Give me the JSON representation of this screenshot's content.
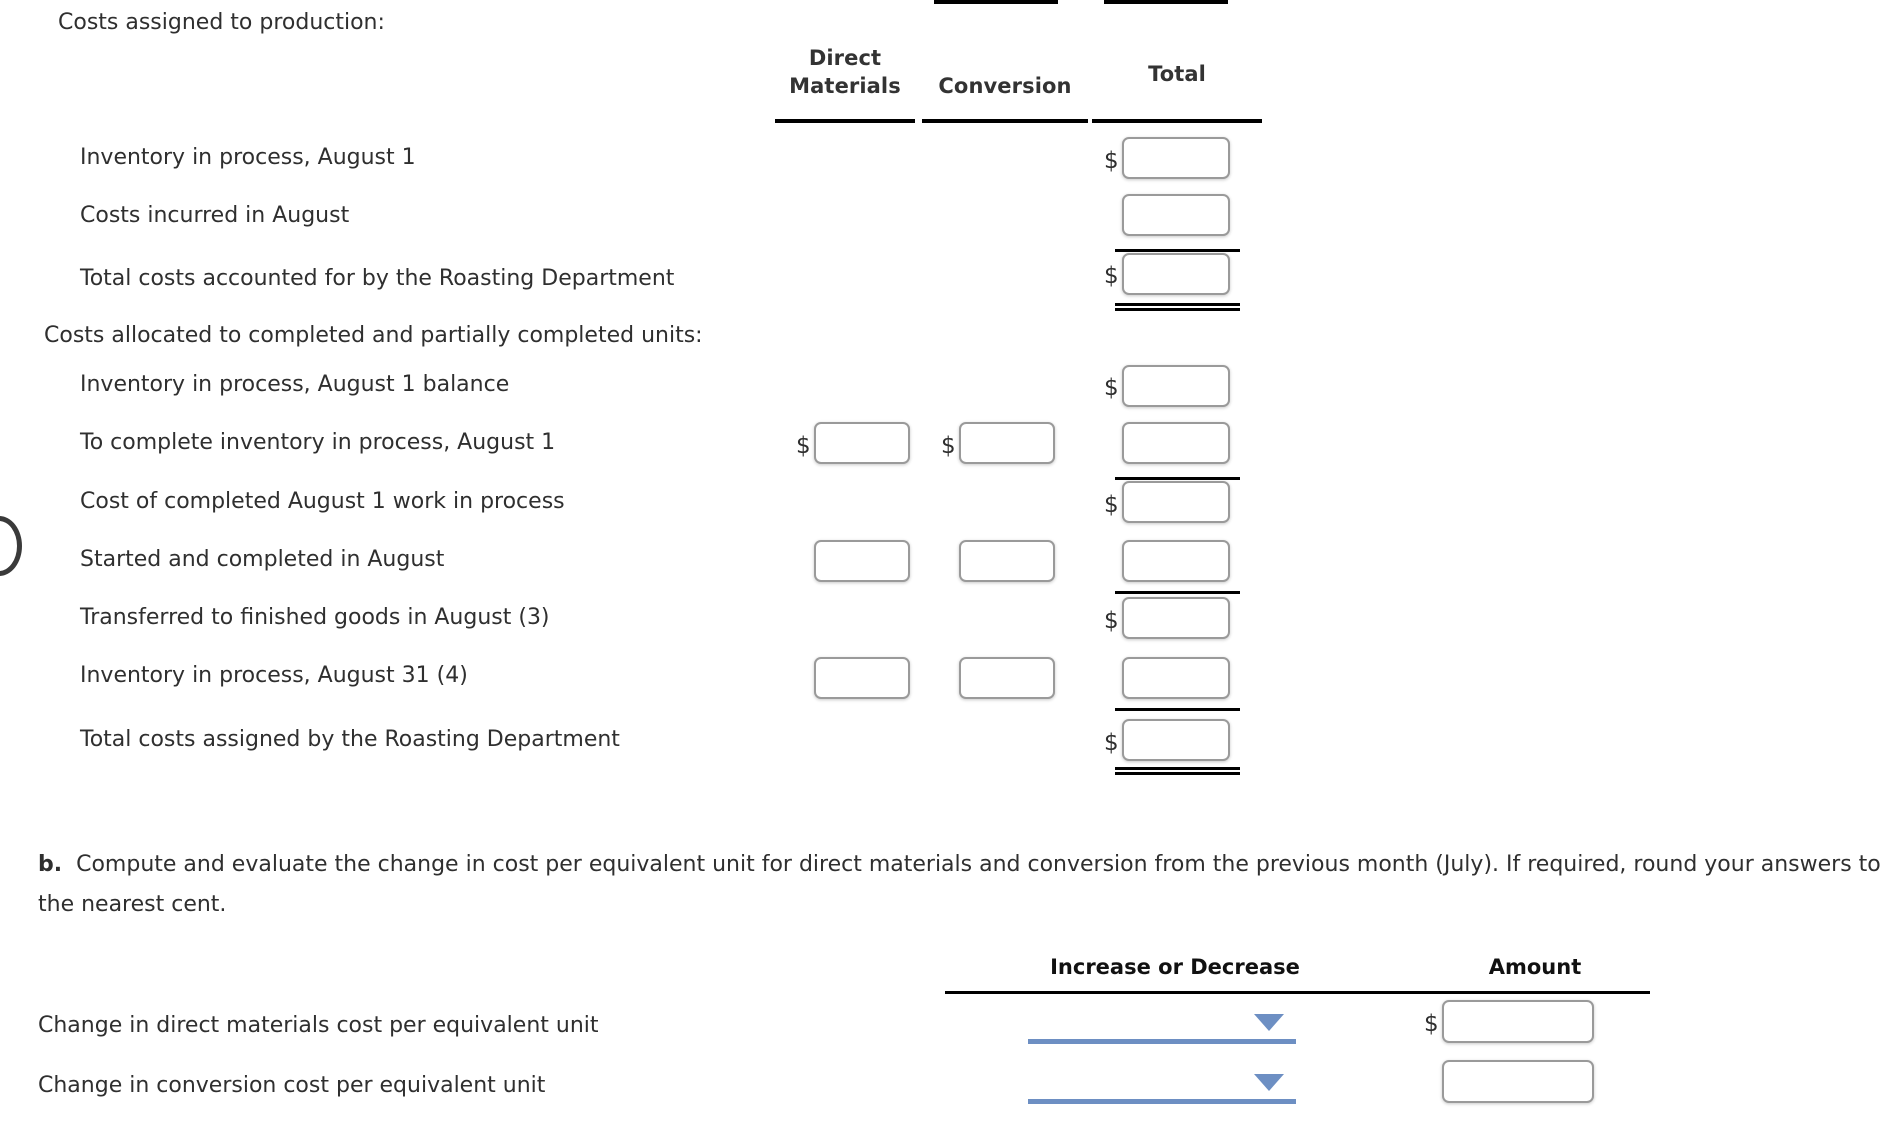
{
  "section_a": {
    "heading_costs_assigned": "Costs assigned to production:",
    "heading_costs_allocated": "Costs allocated to completed and partially completed units:",
    "columns": {
      "direct_materials_line1": "Direct",
      "direct_materials_line2": "Materials",
      "conversion": "Conversion",
      "total": "Total"
    },
    "currency_symbol": "$",
    "rows": [
      {
        "label": "Inventory in process, August 1",
        "dm": "",
        "cv": "",
        "total": ""
      },
      {
        "label": "Costs incurred in August",
        "dm": "",
        "cv": "",
        "total": ""
      },
      {
        "label": "Total costs accounted for by the Roasting Department",
        "dm": "",
        "cv": "",
        "total": ""
      },
      {
        "label": "Inventory in process, August 1 balance",
        "dm": "",
        "cv": "",
        "total": ""
      },
      {
        "label": "To complete inventory in process, August 1",
        "dm": "",
        "cv": "",
        "total": ""
      },
      {
        "label": "Cost of completed August 1 work in process",
        "dm": "",
        "cv": "",
        "total": ""
      },
      {
        "label": "Started and completed in August",
        "dm": "",
        "cv": "",
        "total": ""
      },
      {
        "label": "Transferred to finished goods in August (3)",
        "dm": "",
        "cv": "",
        "total": ""
      },
      {
        "label": "Inventory in process, August 31 (4)",
        "dm": "",
        "cv": "",
        "total": ""
      },
      {
        "label": "Total costs assigned by the Roasting Department",
        "dm": "",
        "cv": "",
        "total": ""
      }
    ]
  },
  "section_b": {
    "marker": "b.",
    "instructions": "Compute and evaluate the change in cost per equivalent unit for direct materials and conversion from the previous month (July). If required, round your answers to the nearest cent.",
    "columns": {
      "increase_or_decrease": "Increase or Decrease",
      "amount": "Amount"
    },
    "currency_symbol": "$",
    "rows": [
      {
        "label": "Change in direct materials cost per equivalent unit",
        "selection": "",
        "amount": ""
      },
      {
        "label": "Change in conversion cost per equivalent unit",
        "selection": "",
        "amount": ""
      }
    ],
    "select_placeholder": ""
  },
  "colors": {
    "select_accent": "#6d8fc3",
    "rule": "#000000",
    "input_border": "#9a9a9a",
    "text": "#2f2f2f"
  },
  "icons": {
    "caret": "chevron-down-icon"
  }
}
